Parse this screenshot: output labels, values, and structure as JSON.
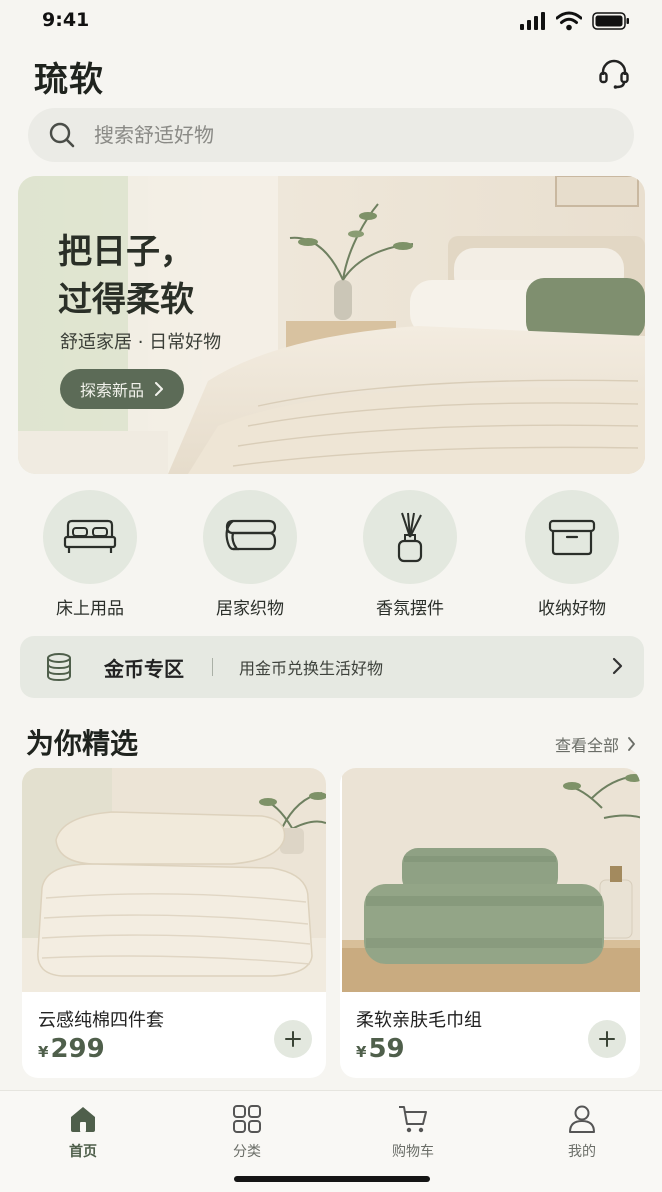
{
  "status_bar": {
    "time": "9:41"
  },
  "header": {
    "title": "琉软"
  },
  "search": {
    "placeholder": "搜索舒适好物"
  },
  "hero": {
    "title": "把日子，\n过得柔软",
    "subtitle": "舒适家居 · 日常好物",
    "cta_label": "探索新品"
  },
  "categories": [
    {
      "label": "床上用品",
      "icon": "bed-icon"
    },
    {
      "label": "居家织物",
      "icon": "folded-fabric-icon"
    },
    {
      "label": "香氛摆件",
      "icon": "diffuser-icon"
    },
    {
      "label": "收纳好物",
      "icon": "storage-box-icon"
    }
  ],
  "coin_zone": {
    "title": "金币专区",
    "description": "用金币兑换生活好物"
  },
  "featured": {
    "title": "为你精选",
    "view_all": "查看全部"
  },
  "products": [
    {
      "name": "云感纯棉四件套",
      "currency": "¥",
      "price": "299"
    },
    {
      "name": "柔软亲肤毛巾组",
      "currency": "¥",
      "price": "59"
    }
  ],
  "tabs": [
    {
      "label": "首页",
      "icon": "home-icon",
      "active": true
    },
    {
      "label": "分类",
      "icon": "grid-icon",
      "active": false
    },
    {
      "label": "购物车",
      "icon": "cart-icon",
      "active": false
    },
    {
      "label": "我的",
      "icon": "user-icon",
      "active": false
    }
  ],
  "colors": {
    "accent": "#5c6b57",
    "background": "#f6f5f1",
    "chip": "#e3e8df"
  }
}
